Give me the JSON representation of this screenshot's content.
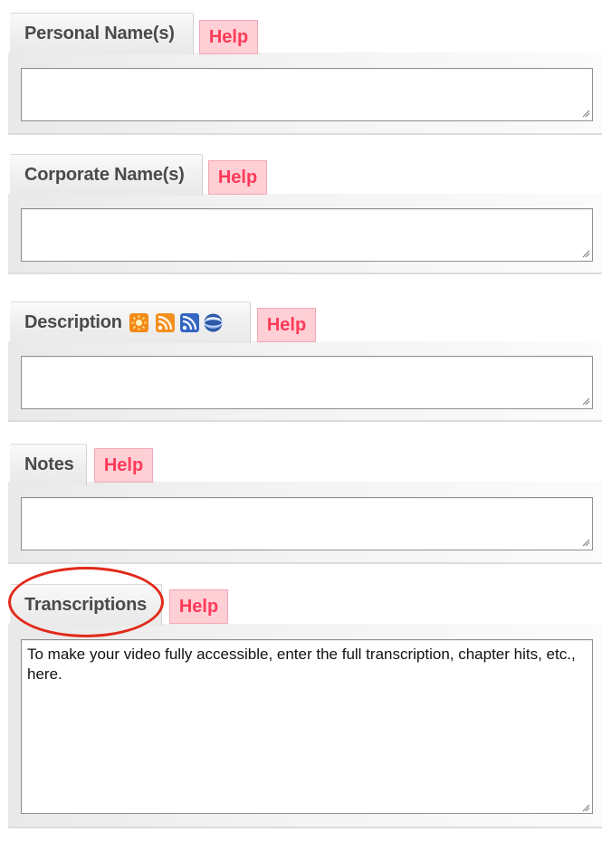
{
  "sections": [
    {
      "label": "Personal Name(s)",
      "help": "Help",
      "value": ""
    },
    {
      "label": "Corporate Name(s)",
      "help": "Help",
      "value": ""
    },
    {
      "label": "Description",
      "help": "Help",
      "value": ""
    },
    {
      "label": "Notes",
      "help": "Help",
      "value": ""
    },
    {
      "label": "Transcriptions",
      "help": "Help",
      "value": "To make your video fully accessible, enter the full transcription, chapter hits, etc., here."
    }
  ],
  "description_icons": [
    "sun-burst-icon",
    "rss-feed-icon",
    "rss-feed-blue-icon",
    "globe-icon"
  ],
  "colors": {
    "help_bg": "#ffcfd6",
    "help_text": "#ff3a59",
    "highlight_circle": "#e12a1a"
  }
}
